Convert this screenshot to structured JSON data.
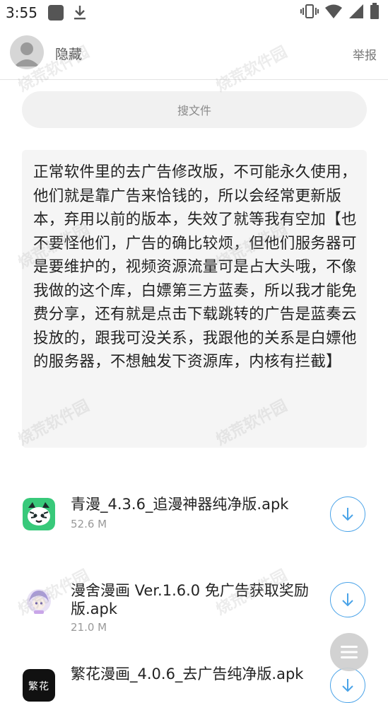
{
  "status_bar": {
    "time": "3:55",
    "icons": [
      "app-notification-icon",
      "download-icon",
      "vibrate-icon",
      "wifi-icon",
      "signal-icon",
      "battery-icon"
    ]
  },
  "header": {
    "username": "隐藏",
    "report_label": "举报"
  },
  "search": {
    "placeholder": "搜文件"
  },
  "notice": {
    "text": "正常软件里的去广告修改版，不可能永久使用，他们就是靠广告来恰钱的，所以会经常更新版本，弃用以前的版本，失效了就等我有空加【也不要怪他们，广告的确比较烦，但他们服务器可是要维护的，视频资源流量可是占大头哦，不像我做的这个库，白嫖第三方蓝奏，所以我才能免费分享，还有就是点击下载跳转的广告是蓝奏云投放的，跟我可没关系，我跟他的关系是白嫖他的服务器，不想触发下资源库，内核有拦截】"
  },
  "files": [
    {
      "name": "青漫_4.3.6_追漫神器纯净版.apk",
      "size": "52.6 M",
      "icon": "qingman-app-icon"
    },
    {
      "name": "漫舍漫画 Ver.1.6.0 免广告获取奖励版.apk",
      "size": "21.0 M",
      "icon": "manshe-app-icon"
    },
    {
      "name": "繁花漫画_4.0.6_去广告纯净版.apk",
      "size": "",
      "icon": "fanhua-app-icon",
      "icon_text": "繁花"
    }
  ],
  "watermark": "烧荒软件园",
  "colors": {
    "accent": "#4aa3e8",
    "notice_bg": "#f5f5f5",
    "search_bg": "#f1f1f1"
  }
}
